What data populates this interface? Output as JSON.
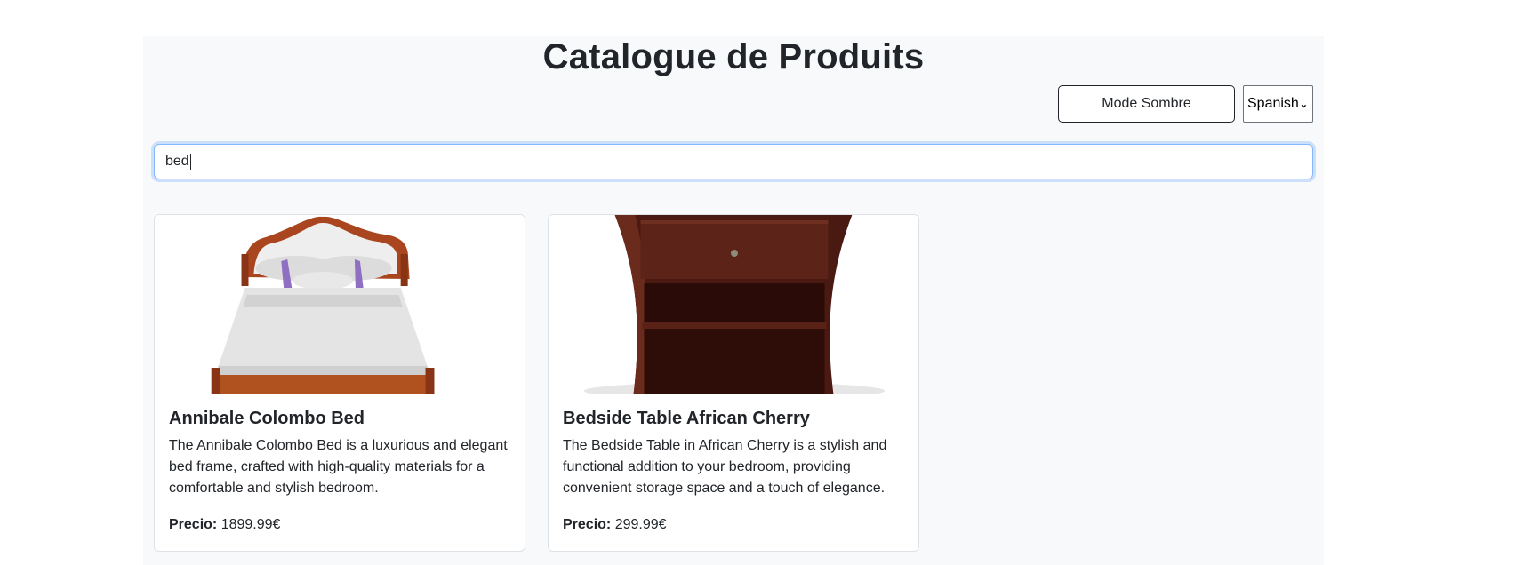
{
  "page": {
    "title": "Catalogue de Produits"
  },
  "controls": {
    "mode_label": "Mode Sombre",
    "language_selected": "Spanish"
  },
  "search": {
    "value": "bed"
  },
  "products": [
    {
      "name": "Annibale Colombo Bed",
      "description": "The Annibale Colombo Bed is a luxurious and elegant bed frame, crafted with high-quality materials for a comfortable and stylish bedroom.",
      "price_label": "Precio:",
      "price": "1899.99€"
    },
    {
      "name": "Bedside Table African Cherry",
      "description": "The Bedside Table in African Cherry is a stylish and functional addition to your bedroom, providing convenient storage space and a touch of elegance.",
      "price_label": "Precio:",
      "price": "299.99€"
    }
  ],
  "icons": {
    "language_dropdown": "chevron-down-icon"
  }
}
